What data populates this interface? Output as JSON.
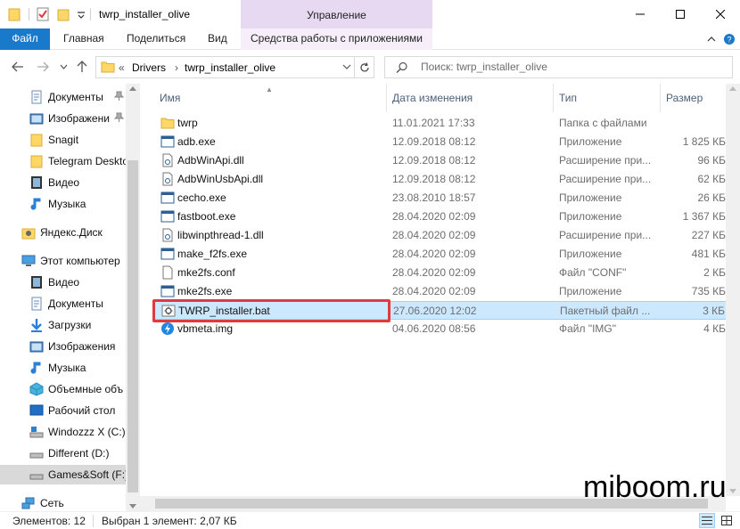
{
  "window": {
    "title": "twrp_installer_olive",
    "context_tab": "Управление"
  },
  "ribbon": {
    "tabs": [
      "Файл",
      "Главная",
      "Поделиться",
      "Вид",
      "Средства работы с приложениями"
    ]
  },
  "address": {
    "overflow": "«",
    "crumbs": [
      "Drivers",
      "twrp_installer_olive"
    ],
    "separator": "›"
  },
  "search": {
    "placeholder": "Поиск: twrp_installer_olive"
  },
  "nav": {
    "items": [
      {
        "label": "Документы",
        "icon": "documents-icon",
        "pinned": true
      },
      {
        "label": "Изображени",
        "icon": "pictures-icon",
        "pinned": true
      },
      {
        "label": "Snagit",
        "icon": "folder-icon",
        "pinned": false
      },
      {
        "label": "Telegram Deskto",
        "icon": "folder-icon",
        "pinned": false
      },
      {
        "label": "Видео",
        "icon": "video-icon",
        "pinned": false
      },
      {
        "label": "Музыка",
        "icon": "music-icon",
        "pinned": false
      },
      {
        "label": "Яндекс.Диск",
        "icon": "yandex-disk-icon",
        "pinned": false
      },
      {
        "label": "Этот компьютер",
        "icon": "computer-icon",
        "pinned": false
      },
      {
        "label": "Видео",
        "icon": "video-icon",
        "pinned": false
      },
      {
        "label": "Документы",
        "icon": "documents-icon",
        "pinned": false
      },
      {
        "label": "Загрузки",
        "icon": "downloads-icon",
        "pinned": false
      },
      {
        "label": "Изображения",
        "icon": "pictures-icon",
        "pinned": false
      },
      {
        "label": "Музыка",
        "icon": "music-icon",
        "pinned": false
      },
      {
        "label": "Объемные объ",
        "icon": "3d-objects-icon",
        "pinned": false
      },
      {
        "label": "Рабочий стол",
        "icon": "desktop-icon",
        "pinned": false
      },
      {
        "label": "Windozzz X (C:)",
        "icon": "drive-c-icon",
        "pinned": false
      },
      {
        "label": "Different (D:)",
        "icon": "drive-icon",
        "pinned": false
      },
      {
        "label": "Games&Soft (F:)",
        "icon": "drive-icon",
        "pinned": false
      },
      {
        "label": "Сеть",
        "icon": "network-icon",
        "pinned": false
      }
    ]
  },
  "columns": {
    "name": "Имя",
    "date": "Дата изменения",
    "type": "Тип",
    "size": "Размер"
  },
  "files": [
    {
      "name": "twrp",
      "date": "11.01.2021 17:33",
      "type": "Папка с файлами",
      "size": "",
      "icon": "folder-icon"
    },
    {
      "name": "adb.exe",
      "date": "12.09.2018 08:12",
      "type": "Приложение",
      "size": "1 825 КБ",
      "icon": "exe-icon"
    },
    {
      "name": "AdbWinApi.dll",
      "date": "12.09.2018 08:12",
      "type": "Расширение при...",
      "size": "96 КБ",
      "icon": "dll-icon"
    },
    {
      "name": "AdbWinUsbApi.dll",
      "date": "12.09.2018 08:12",
      "type": "Расширение при...",
      "size": "62 КБ",
      "icon": "dll-icon"
    },
    {
      "name": "cecho.exe",
      "date": "23.08.2010 18:57",
      "type": "Приложение",
      "size": "26 КБ",
      "icon": "exe-icon"
    },
    {
      "name": "fastboot.exe",
      "date": "28.04.2020 02:09",
      "type": "Приложение",
      "size": "1 367 КБ",
      "icon": "exe-icon"
    },
    {
      "name": "libwinpthread-1.dll",
      "date": "28.04.2020 02:09",
      "type": "Расширение при...",
      "size": "227 КБ",
      "icon": "dll-icon"
    },
    {
      "name": "make_f2fs.exe",
      "date": "28.04.2020 02:09",
      "type": "Приложение",
      "size": "481 КБ",
      "icon": "exe-icon"
    },
    {
      "name": "mke2fs.conf",
      "date": "28.04.2020 02:09",
      "type": "Файл \"CONF\"",
      "size": "2 КБ",
      "icon": "file-icon"
    },
    {
      "name": "mke2fs.exe",
      "date": "28.04.2020 02:09",
      "type": "Приложение",
      "size": "735 КБ",
      "icon": "exe-icon"
    },
    {
      "name": "TWRP_installer.bat",
      "date": "27.06.2020 12:02",
      "type": "Пакетный файл ...",
      "size": "3 КБ",
      "icon": "bat-icon"
    },
    {
      "name": "vbmeta.img",
      "date": "04.06.2020 08:56",
      "type": "Файл \"IMG\"",
      "size": "4 КБ",
      "icon": "img-file-icon"
    }
  ],
  "selected_row": 10,
  "watermark": "miboom.ru",
  "status": {
    "count": "Элементов: 12",
    "selection": "Выбран 1 элемент: 2,07 КБ"
  },
  "colors": {
    "file_tab": "#1979ca",
    "context_tab": "#e8d9f2",
    "selection": "#cce8ff",
    "highlight_box": "#e0393e",
    "folder": "#ffd766"
  }
}
